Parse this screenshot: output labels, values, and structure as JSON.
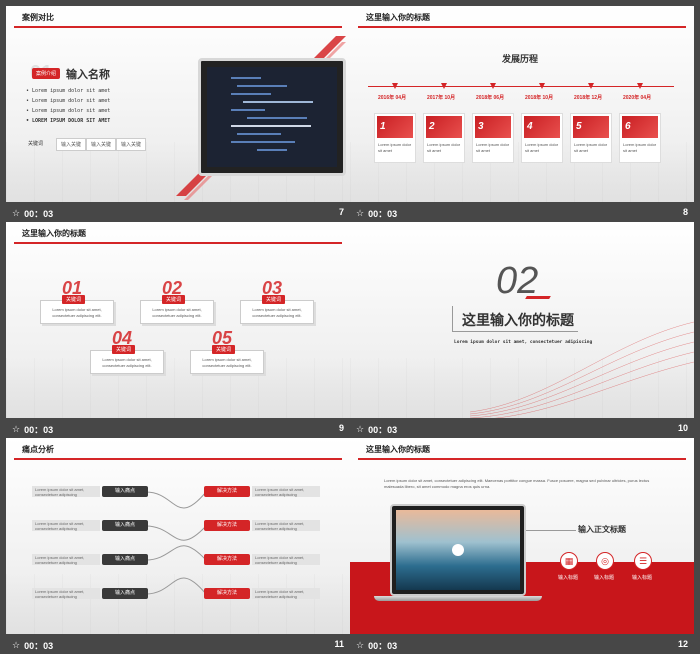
{
  "colors": {
    "accent": "#d42527",
    "background": "#474747"
  },
  "slides": [
    {
      "time": "00：03",
      "number": "7",
      "title": "案例对比",
      "tag": "案例介绍",
      "heading": "输入名称",
      "bullets": [
        "Lorem ipsum dolor sit amet",
        "Lorem ipsum dolor sit amet",
        "Lorem ipsum dolor sit amet",
        "LOREM IPSUM DOLOR SIT AMET"
      ],
      "keyword_label": "关键词",
      "keywords": [
        "输入关键",
        "输入关键",
        "输入关键"
      ]
    },
    {
      "time": "00：03",
      "number": "8",
      "title": "这里输入你的标题",
      "heading": "发展历程",
      "dates": [
        "2016年  04月",
        "2017年  10月",
        "2018年  06月",
        "2018年  10月",
        "2018年  12月",
        "2020年  04月"
      ],
      "cards": [
        {
          "n": "1",
          "text": "Lorem ipsum dolor sit amet"
        },
        {
          "n": "2",
          "text": "Lorem ipsum dolor sit amet"
        },
        {
          "n": "3",
          "text": "Lorem ipsum dolor sit amet"
        },
        {
          "n": "4",
          "text": "Lorem ipsum dolor sit amet"
        },
        {
          "n": "5",
          "text": "Lorem ipsum dolor sit amet"
        },
        {
          "n": "6",
          "text": "Lorem ipsum dolor sit amet"
        }
      ]
    },
    {
      "time": "00：03",
      "number": "9",
      "title": "这里输入你的标题",
      "items": [
        {
          "n": "01",
          "kw": "关键词",
          "text": "Lorem ipsum dolor sit amet, consectetuer adipiscing elit."
        },
        {
          "n": "02",
          "kw": "关键词",
          "text": "Lorem ipsum dolor sit amet, consectetuer adipiscing elit."
        },
        {
          "n": "03",
          "kw": "关键词",
          "text": "Lorem ipsum dolor sit amet, consectetuer adipiscing elit."
        },
        {
          "n": "04",
          "kw": "关键词",
          "text": "Lorem ipsum dolor sit amet, consectetuer adipiscing elit."
        },
        {
          "n": "05",
          "kw": "关键词",
          "text": "Lorem ipsum dolor sit amet, consectetuer adipiscing elit."
        }
      ]
    },
    {
      "time": "00：03",
      "number": "10",
      "big_number": "02",
      "heading": "这里输入你的标题",
      "subtitle": "Lorem ipsum dolor sit amet, consectetuer adipiscing"
    },
    {
      "time": "00：03",
      "number": "11",
      "title": "痛点分析",
      "left_text": "Lorem ipsum dolor sit amet, consectetuer adipiscing",
      "pain": "输入痛点",
      "solution": "解决方法",
      "right_text": "Lorem ipsum dolor sit amet, consectetuer adipiscing"
    },
    {
      "time": "00：03",
      "number": "12",
      "title": "这里输入你的标题",
      "paragraph": "Lorem ipsum dolor sit amet, consectetuer adipiscing elit. Maecenas porttitor congue massa. Fusce posuere, magna sed pulvinar ultricies, purus lectus malesuada libero, sit amet commodo magna eros quis urna.",
      "heading": "输入正文标题",
      "icons": [
        {
          "icon": "calendar-icon",
          "label": "输入标题"
        },
        {
          "icon": "globe-icon",
          "label": "输入标题"
        },
        {
          "icon": "list-icon",
          "label": "输入标题"
        }
      ]
    }
  ]
}
